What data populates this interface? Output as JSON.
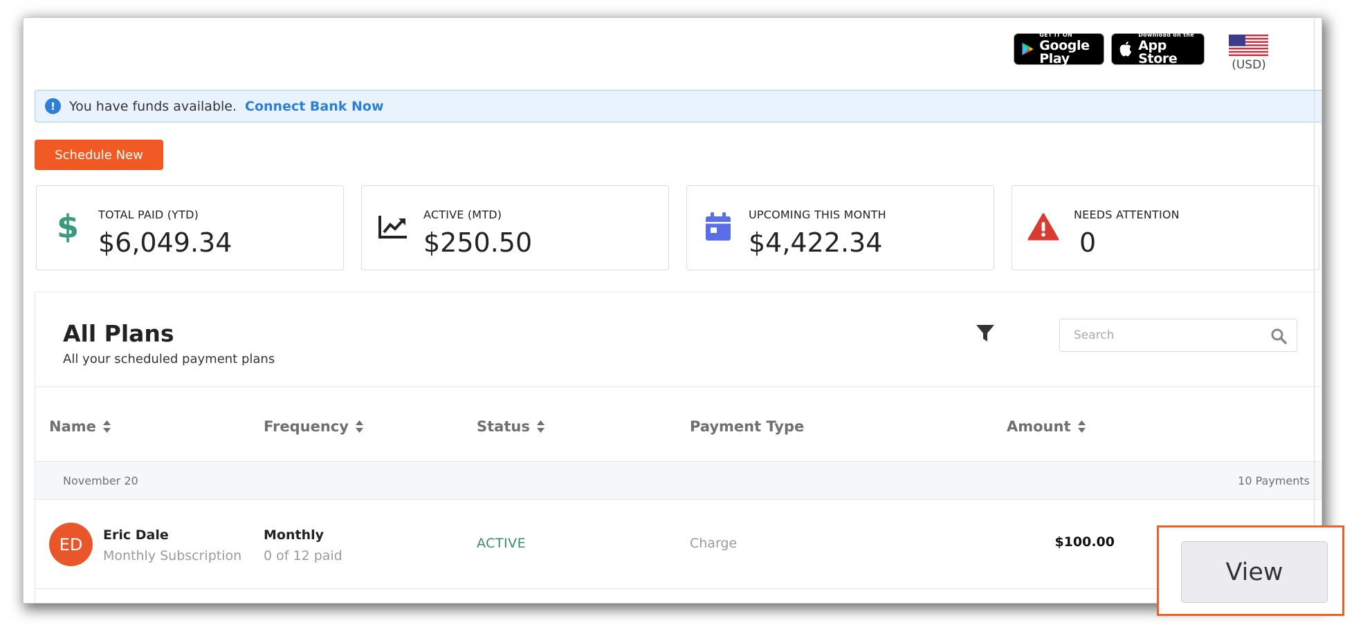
{
  "header": {
    "google_play": {
      "small": "GET IT ON",
      "big": "Google Play"
    },
    "app_store": {
      "small": "Download on the",
      "big": "App Store"
    },
    "currency": "(USD)"
  },
  "alert": {
    "message": "You have funds available.",
    "link": "Connect Bank Now"
  },
  "schedule_button": "Schedule New",
  "stats": [
    {
      "label": "TOTAL PAID (YTD)",
      "value": "$6,049.34",
      "icon": "dollar-icon",
      "color": "#3a9a7a"
    },
    {
      "label": "ACTIVE (MTD)",
      "value": "$250.50",
      "icon": "trend-up-icon",
      "color": "#222222"
    },
    {
      "label": "UPCOMING THIS MONTH",
      "value": "$4,422.34",
      "icon": "calendar-icon",
      "color": "#5b6ee8"
    },
    {
      "label": "NEEDS ATTENTION",
      "value": "0",
      "icon": "warning-icon",
      "color": "#d93a32"
    }
  ],
  "plans": {
    "title": "All Plans",
    "subtitle": "All your scheduled payment plans",
    "search_placeholder": "Search",
    "columns": [
      "Name",
      "Frequency",
      "Status",
      "Payment Type",
      "Amount"
    ],
    "group": {
      "date": "November 20",
      "count": "10 Payments"
    },
    "row": {
      "initials": "ED",
      "name": "Eric Dale",
      "plan": "Monthly Subscription",
      "frequency": "Monthly",
      "progress": "0 of 12 paid",
      "status": "ACTIVE",
      "payment_type": "Charge",
      "amount": "$100.00",
      "action": "View"
    }
  }
}
